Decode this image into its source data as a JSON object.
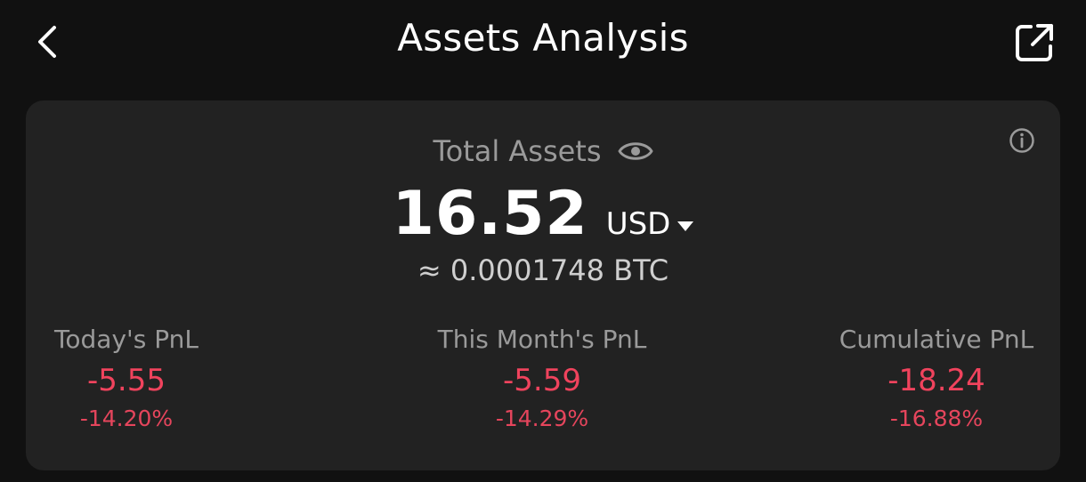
{
  "header": {
    "title": "Assets Analysis",
    "back_icon": "chevron-left-icon",
    "share_icon": "external-link-icon"
  },
  "summary": {
    "label": "Total Assets",
    "amount": "16.52",
    "currency": "USD",
    "btc_equivalent": "≈ 0.0001748 BTC"
  },
  "pnl": [
    {
      "label": "Today's PnL",
      "value": "-5.55",
      "percent": "-14.20%"
    },
    {
      "label": "This Month's PnL",
      "value": "-5.59",
      "percent": "-14.29%"
    },
    {
      "label": "Cumulative PnL",
      "value": "-18.24",
      "percent": "-16.88%"
    }
  ],
  "colors": {
    "background": "#111111",
    "card": "#222222",
    "negative": "#f0435d",
    "muted_text": "#9a9a9a"
  }
}
